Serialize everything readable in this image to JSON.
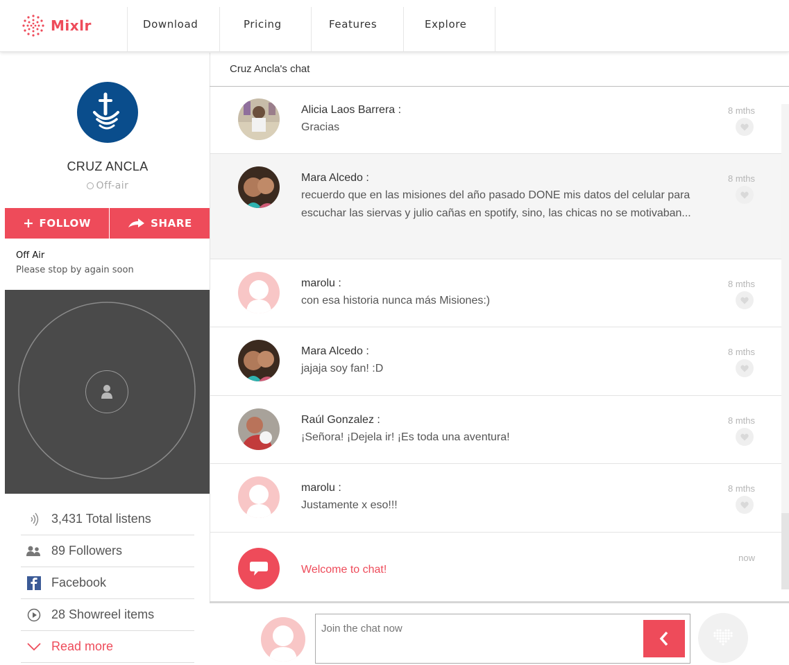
{
  "nav": {
    "brand": "Mixlr",
    "links": [
      "Download",
      "Pricing",
      "Features",
      "Explore"
    ]
  },
  "station": {
    "name": "CRUZ ANCLA",
    "status": "Off-air",
    "follow_label": "FOLLOW",
    "share_label": "SHARE",
    "offair_title": "Off Air",
    "offair_message": "Please stop by again soon"
  },
  "stats": {
    "listens": "3,431 Total listens",
    "followers": "89 Followers",
    "facebook": "Facebook",
    "showreel": "28 Showreel items",
    "read_more": "Read more"
  },
  "chat": {
    "title": "Cruz Ancla's chat",
    "messages": [
      {
        "author": "Alicia Laos Barrera :",
        "text": "Gracias",
        "time": "8 mths"
      },
      {
        "author": "Mara Alcedo :",
        "text": "recuerdo que en las misiones del año pasado DONE mis datos del celular para escuchar las siervas y julio cañas en spotify, sino, las chicas no se motivaban...",
        "time": "8 mths"
      },
      {
        "author": "marolu :",
        "text": "con esa historia nunca más Misiones:)",
        "time": "8 mths"
      },
      {
        "author": "Mara Alcedo :",
        "text": "jajaja soy fan! :D",
        "time": "8 mths"
      },
      {
        "author": "Raúl Gonzalez :",
        "text": "¡Señora! ¡Dejela ir! ¡Es toda una aventura!",
        "time": "8 mths"
      },
      {
        "author": "marolu :",
        "text": "Justamente x eso!!!",
        "time": "8 mths"
      }
    ],
    "welcome": {
      "text": "Welcome to chat!",
      "time": "now"
    },
    "input_placeholder": "Join the chat now"
  },
  "colors": {
    "accent": "#ee4b5a",
    "brand_blue": "#0a4d8c",
    "player_bg": "#4a4a4a"
  },
  "icons": {
    "logo": "mixlr-dots-logo",
    "follow": "plus-icon",
    "share": "share-arrow-icon",
    "listens": "sound-waves-icon",
    "followers": "people-icon",
    "facebook": "facebook-icon",
    "showreel": "play-circle-icon",
    "read_more": "chevron-down-icon",
    "message_like": "heart-icon",
    "send": "chevron-left-icon"
  }
}
